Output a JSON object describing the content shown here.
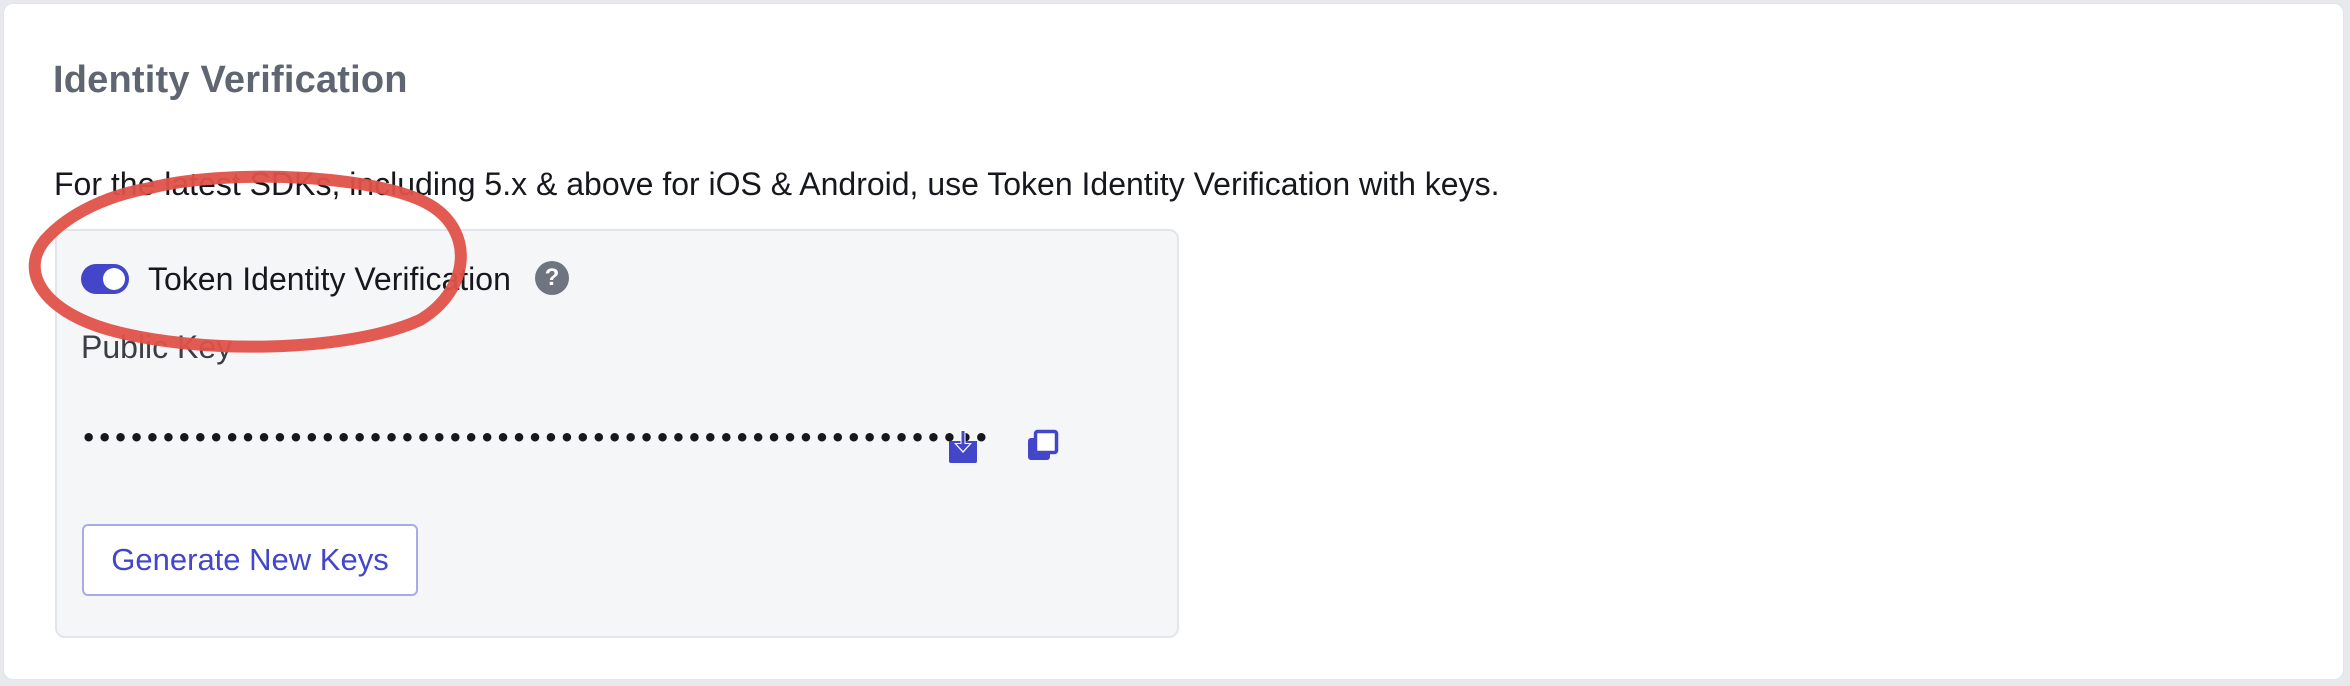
{
  "section": {
    "title": "Identity Verification",
    "description": "For the latest SDKs, including 5.x & above for iOS & Android, use Token Identity Verification with keys."
  },
  "token_panel": {
    "toggle_label": "Token Identity Verification",
    "toggle_on": true,
    "help_glyph": "?",
    "public_key_label": "Public Key",
    "public_key_masked": "•••••••••••••••••••••••••••••••••••••••••••••••••••••••••",
    "generate_button_label": "Generate New Keys"
  },
  "icons": {
    "help": "help-circle-icon",
    "download": "download-icon",
    "copy": "copy-icon"
  },
  "colors": {
    "accent": "#4346c9",
    "annotation": "#e0524a",
    "title": "#5f6672",
    "panel_background": "#f5f6f8"
  }
}
